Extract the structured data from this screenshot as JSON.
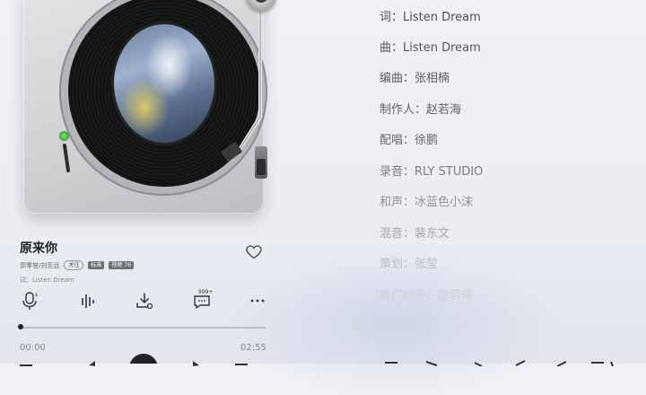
{
  "song": {
    "title": "原来你",
    "artist": "郭零誉/刘至远",
    "follow_label": "关注",
    "tags": [
      "标准",
      "视频 76"
    ],
    "lyric_credit": "词：Listen Dream"
  },
  "actions": {
    "comment_count": "999+"
  },
  "progress": {
    "current_time": "00:00",
    "total_time": "02:55",
    "fraction": 0.0
  },
  "credits": [
    {
      "text": "词：Listen Dream",
      "color": "#4d4d52"
    },
    {
      "text": "曲：Listen Dream",
      "color": "#55555a"
    },
    {
      "text": "编曲：张相楠",
      "color": "#5c5c61"
    },
    {
      "text": "制作人：赵若海",
      "color": "#626267"
    },
    {
      "text": "配唱：徐鹏",
      "color": "#6a6a6f"
    },
    {
      "text": "录音：RLY STUDIO",
      "color": "#7b7b80"
    },
    {
      "text": "和声：冰蓝色小沫",
      "color": "#929297"
    },
    {
      "text": "混音：裴东文",
      "color": "#a8a8ad"
    },
    {
      "text": "策划：张莹",
      "color": "#bfc0c5"
    },
    {
      "text": "推广统筹：赵若海",
      "color": "#d2d3d8"
    }
  ],
  "icons": {
    "app_logo": "q-logo-icon",
    "like": "heart-icon",
    "mic": "microphone-icon",
    "eq": "sound-effect-icon",
    "download": "download-icon",
    "comment": "comment-icon",
    "more": "more-icon"
  }
}
